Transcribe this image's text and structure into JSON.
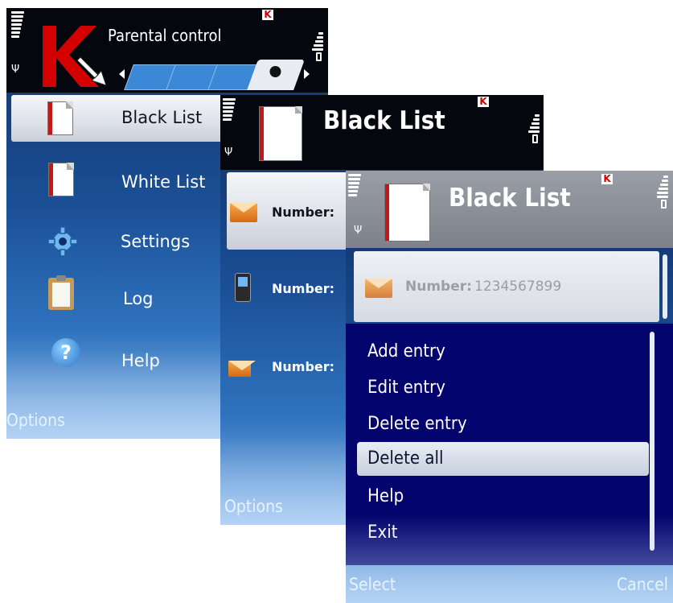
{
  "screen1": {
    "title": "Parental control",
    "menu": [
      {
        "label": "Black List",
        "icon": "black-list-icon"
      },
      {
        "label": "White List",
        "icon": "white-list-icon"
      },
      {
        "label": "Settings",
        "icon": "settings-gear-icon"
      },
      {
        "label": "Log",
        "icon": "clipboard-icon"
      },
      {
        "label": "Help",
        "icon": "help-icon"
      }
    ],
    "softkey_left": "Options"
  },
  "screen2": {
    "title": "Black List",
    "entries": [
      {
        "label": "Number:",
        "icon": "envelope-icon"
      },
      {
        "label": "Number:",
        "icon": "phone-icon"
      },
      {
        "label": "Number:",
        "icon": "envelope-phone-icon"
      }
    ],
    "softkey_left": "Options"
  },
  "screen3": {
    "title": "Black List",
    "entry_label": "Number:",
    "entry_value": "1234567899",
    "options_menu": [
      "Add entry",
      "Edit entry",
      "Delete entry",
      "Delete all",
      "Help",
      "Exit"
    ],
    "selected_option": "Delete all",
    "softkey_left": "Select",
    "softkey_right": "Cancel"
  },
  "colors": {
    "header_dark": "#05070e",
    "menu_blue": "#04046e",
    "kaspersky_red": "#d40000"
  }
}
